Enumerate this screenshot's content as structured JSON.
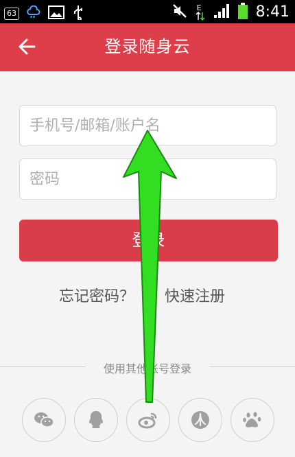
{
  "status_bar": {
    "notification_count": "63",
    "time": "8:41",
    "network_label": "E",
    "icons": [
      "notification-badge-icon",
      "weather-icon",
      "gallery-icon",
      "usb-icon",
      "mute-icon",
      "data-transfer-icon",
      "signal-icon",
      "battery-icon"
    ]
  },
  "app_bar": {
    "title": "登录随身云",
    "back_icon": "back-arrow-icon"
  },
  "form": {
    "account_placeholder": "手机号/邮箱/账户名",
    "password_placeholder": "密码",
    "login_label": "登录"
  },
  "links": {
    "forgot_password": "忘记密码？",
    "register": "快速注册"
  },
  "other_login": {
    "divider_text": "使用其他帐号登录",
    "providers": [
      "wechat-icon",
      "qq-icon",
      "weibo-icon",
      "renren-icon",
      "baidu-icon"
    ]
  },
  "colors": {
    "app_bar": "#de3d4a",
    "login_button": "#d93d49",
    "background": "#f4f4f4",
    "overlay_arrow": "#33dd22"
  },
  "overlay": {
    "description": "upward-arrow-annotation"
  }
}
